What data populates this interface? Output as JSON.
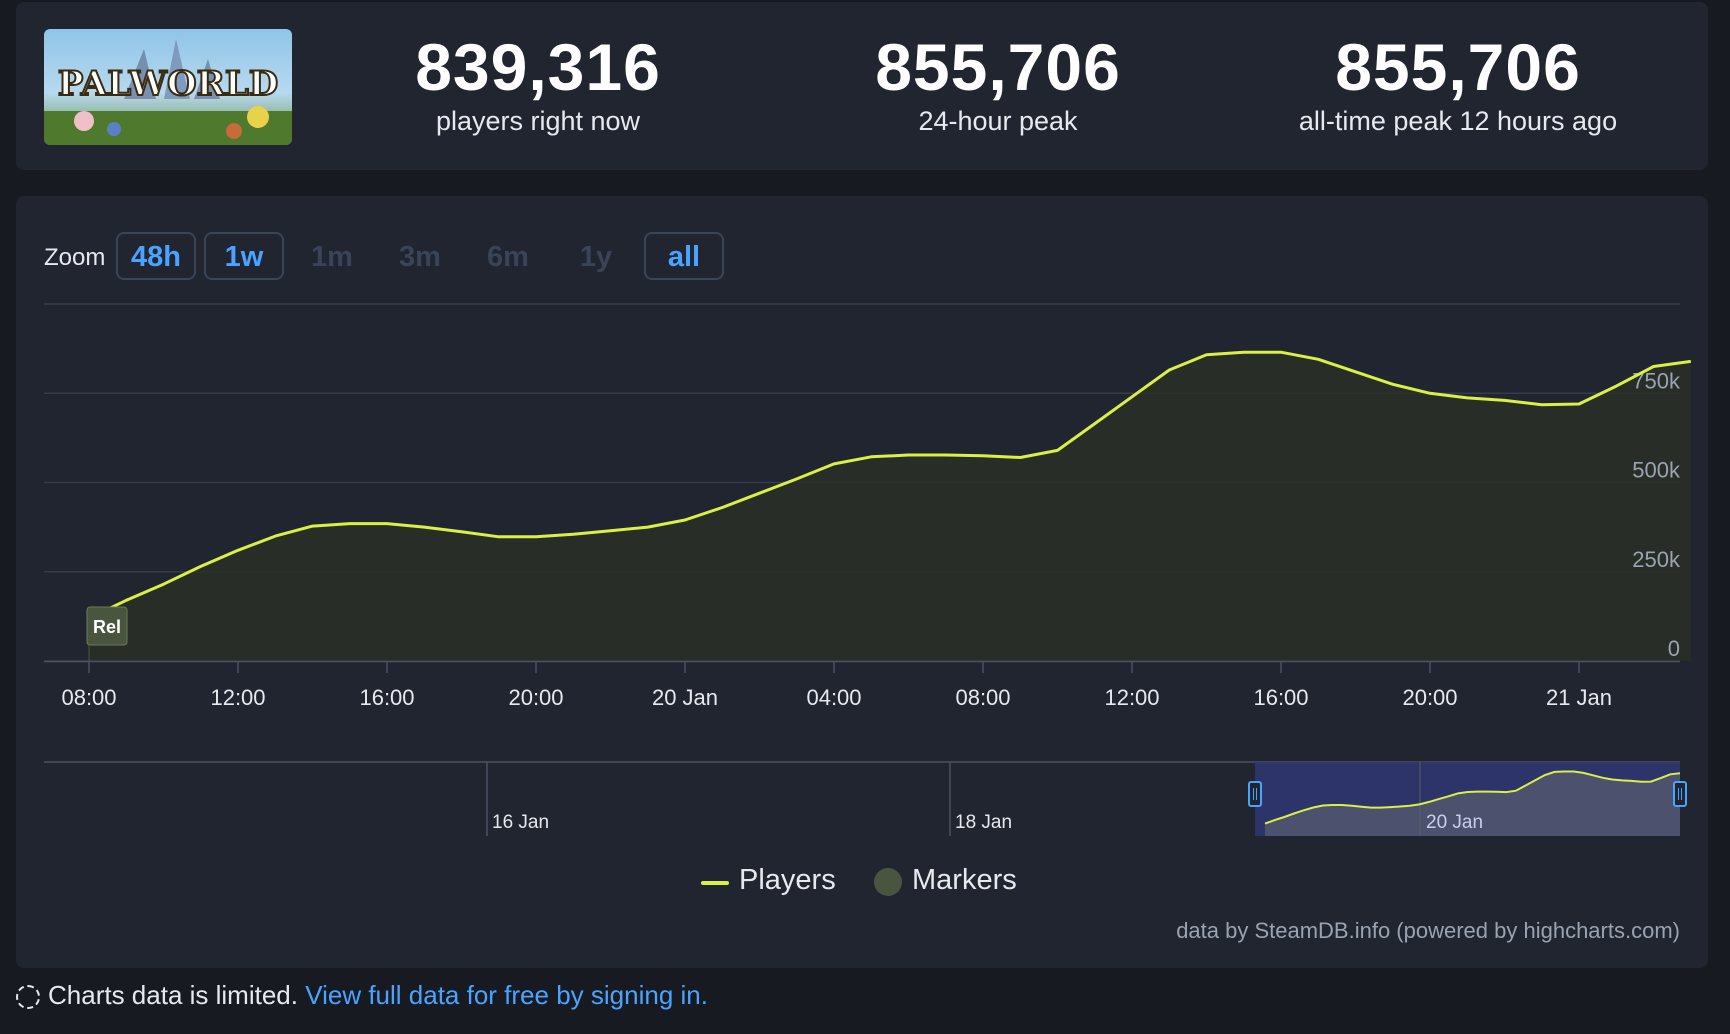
{
  "game": {
    "logo_text": "PALWORLD"
  },
  "stats": [
    {
      "value": "839,316",
      "label": "players right now"
    },
    {
      "value": "855,706",
      "label": "24-hour peak"
    },
    {
      "value": "855,706",
      "label": "all-time peak 12 hours ago"
    }
  ],
  "zoom": {
    "label": "Zoom",
    "buttons": [
      {
        "label": "48h",
        "active": true
      },
      {
        "label": "1w",
        "active": true
      },
      {
        "label": "1m",
        "active": false
      },
      {
        "label": "3m",
        "active": false
      },
      {
        "label": "6m",
        "active": false
      },
      {
        "label": "1y",
        "active": false
      },
      {
        "label": "all",
        "active": true
      }
    ]
  },
  "legend": {
    "players": "Players",
    "markers": "Markers"
  },
  "credits": "data by SteamDB.info (powered by highcharts.com)",
  "notice": {
    "text": "Charts data is limited.",
    "link": "View full data for free by signing in."
  },
  "colors": {
    "line": "#d9f046",
    "marker": "#4a5540",
    "accent": "#4aa3ff",
    "navigator": "#2e3670"
  },
  "chart_data": {
    "type": "line",
    "series": [
      {
        "name": "Players",
        "x": [
          "08:00",
          "09:00",
          "10:00",
          "11:00",
          "12:00",
          "13:00",
          "14:00",
          "15:00",
          "16:00",
          "17:00",
          "18:00",
          "19:00",
          "20:00",
          "21:00",
          "22:00",
          "23:00",
          "20 Jan",
          "01:00",
          "02:00",
          "03:00",
          "04:00",
          "05:00",
          "06:00",
          "07:00",
          "08:00",
          "09:00",
          "10:00",
          "11:00",
          "12:00",
          "13:00",
          "14:00",
          "15:00",
          "16:00",
          "17:00",
          "18:00",
          "19:00",
          "20:00",
          "21:00",
          "22:00",
          "23:00",
          "21 Jan",
          "01:00",
          "02:00",
          "03:00"
        ],
        "values": [
          120000,
          170000,
          215000,
          265000,
          310000,
          350000,
          378000,
          385000,
          385000,
          375000,
          362000,
          348000,
          348000,
          355000,
          365000,
          375000,
          395000,
          430000,
          470000,
          510000,
          552000,
          572000,
          577000,
          577000,
          575000,
          570000,
          590000,
          665000,
          740000,
          815000,
          858000,
          865000,
          865000,
          845000,
          810000,
          775000,
          750000,
          737000,
          730000,
          718000,
          720000,
          770000,
          825000,
          839316
        ]
      }
    ],
    "markers": [
      {
        "x": "08:00",
        "label": "Rel"
      }
    ],
    "x_ticks": [
      "08:00",
      "12:00",
      "16:00",
      "20:00",
      "20 Jan",
      "04:00",
      "08:00",
      "12:00",
      "16:00",
      "20:00",
      "21 Jan"
    ],
    "y_ticks": [
      "0",
      "250k",
      "500k",
      "750k"
    ],
    "ylim": [
      0,
      1000000
    ],
    "grid": true,
    "legend_position": "bottom-center",
    "navigator": {
      "labels": [
        "16 Jan",
        "18 Jan",
        "20 Jan"
      ]
    }
  }
}
